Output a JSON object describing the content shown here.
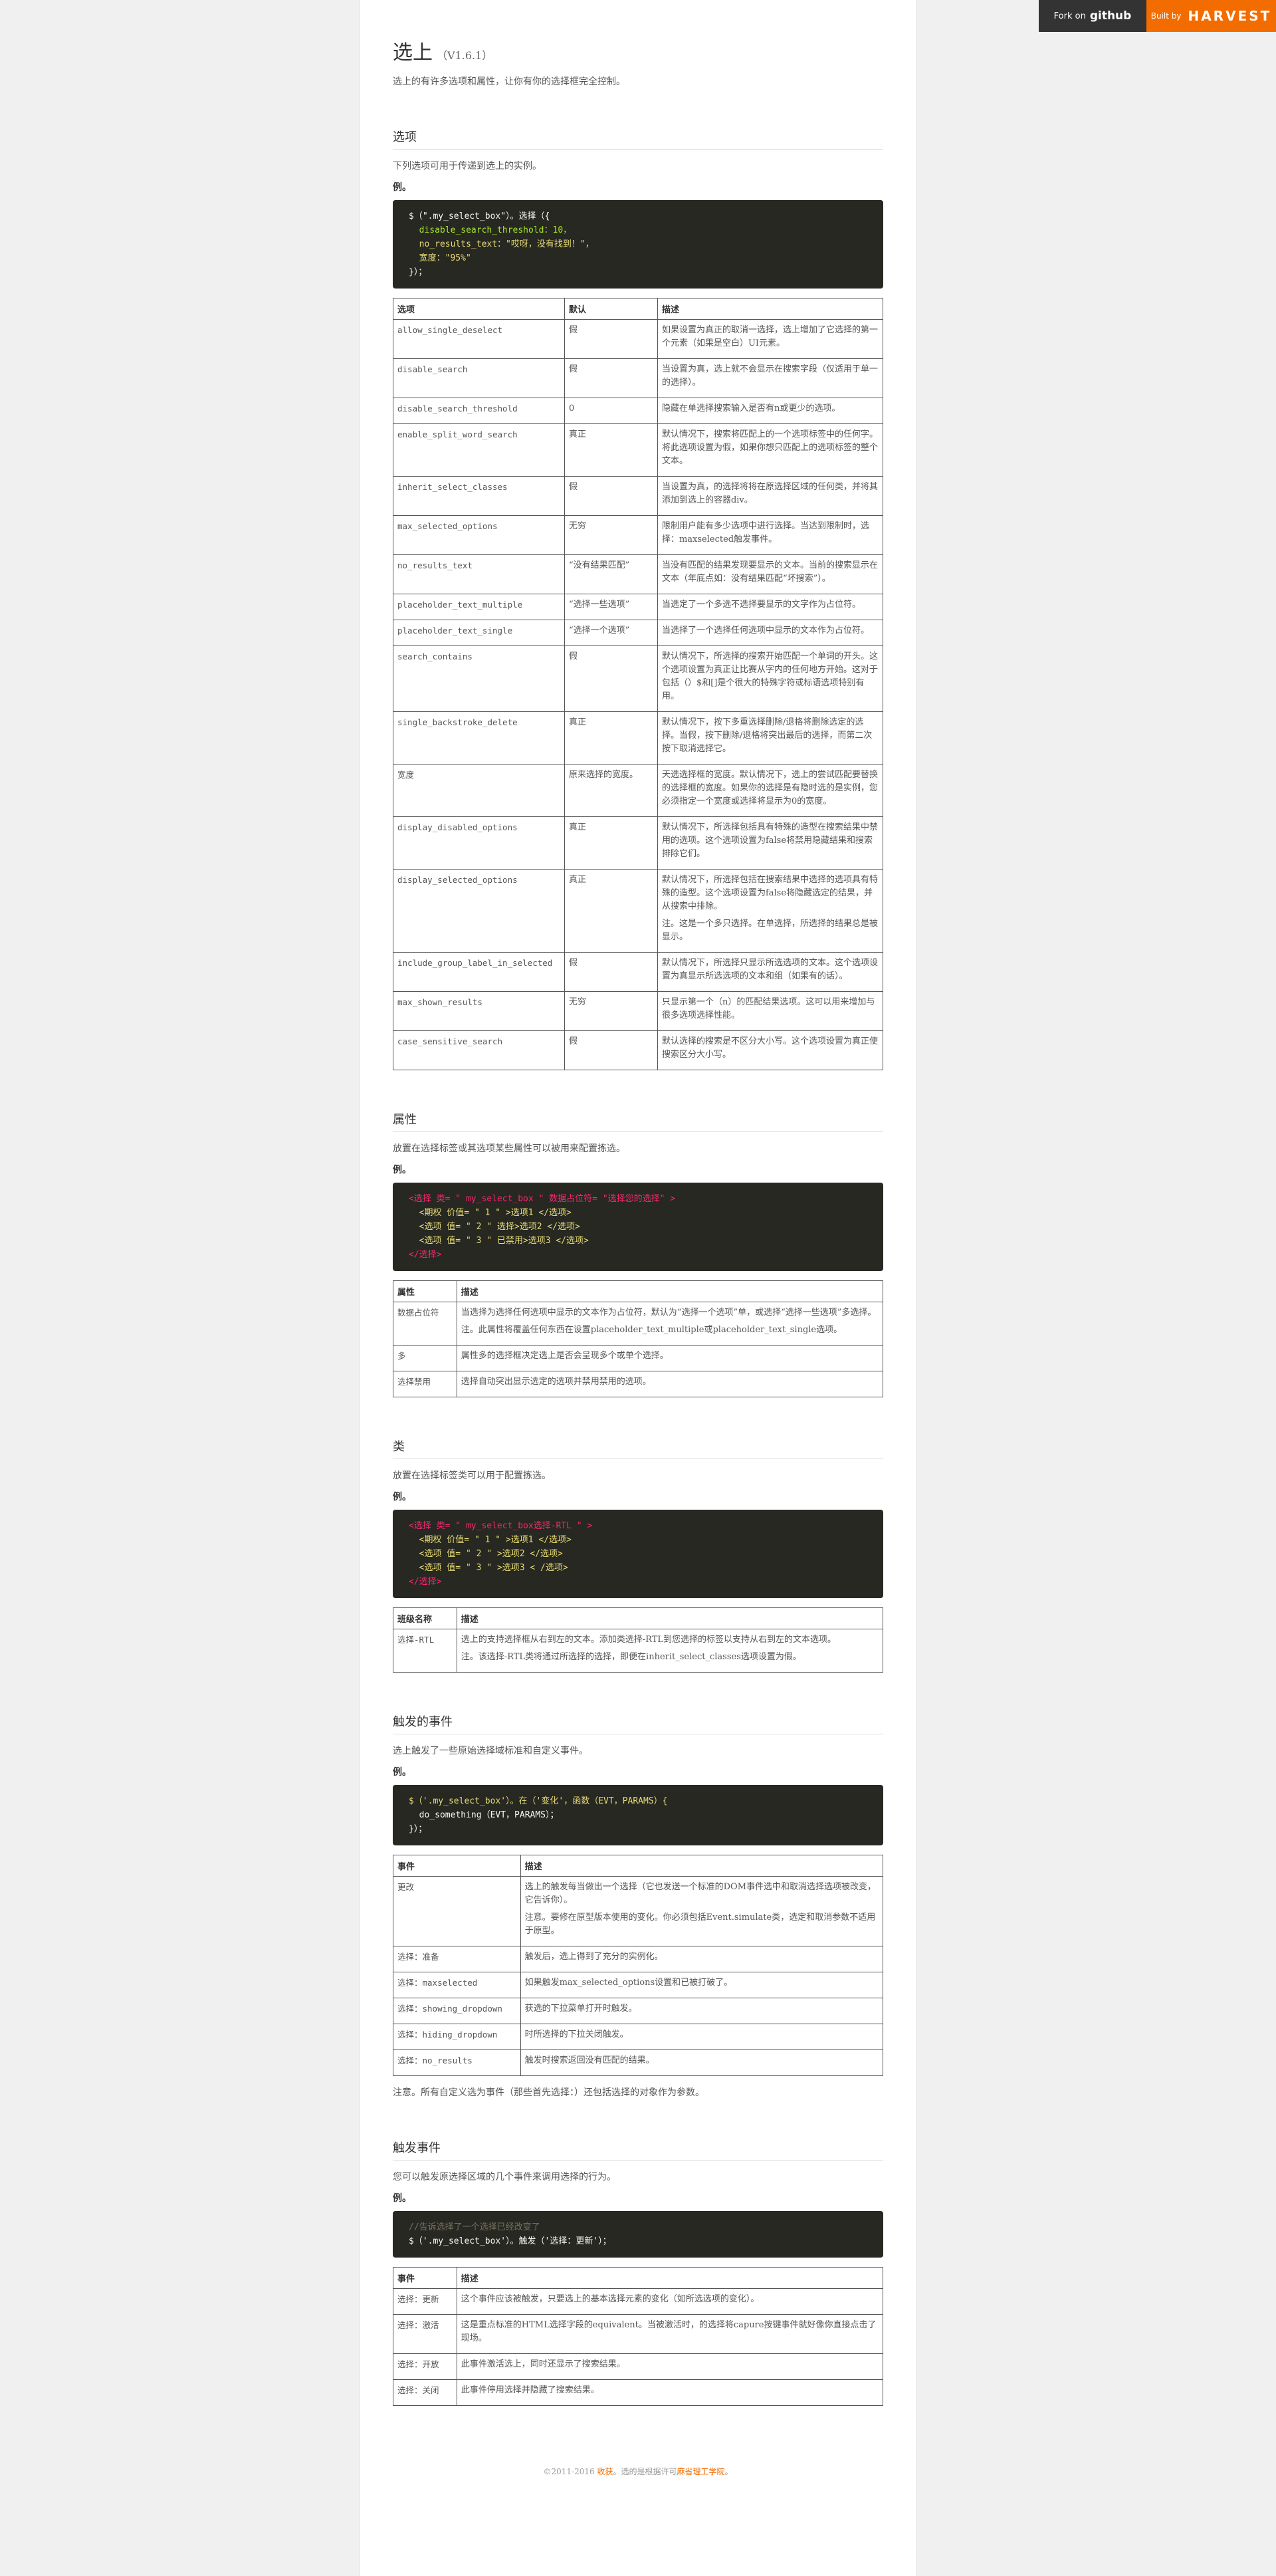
{
  "badges": {
    "github_prefix": "Fork on",
    "github_brand": "github",
    "harvest_prefix": "Built by",
    "harvest_brand": "HARVEST"
  },
  "header": {
    "title": "选上",
    "version": "（V1.6.1）",
    "lead": "选上的有许多选项和属性，让你有你的选择框完全控制。"
  },
  "options": {
    "heading": "选项",
    "desc": "下列选项可用于传递到选上的实例。",
    "example_label": "例。",
    "code": [
      "$（\".my_select_box\"）。选择（{",
      "  disable_search_threshold：10，",
      "  no_results_text：\"哎呀，没有找到！\"，",
      "  宽度：\"95%\"",
      "}）；"
    ],
    "headers": [
      "选项",
      "默认",
      "描述"
    ],
    "rows": [
      {
        "name": "allow_single_deselect",
        "def": "假",
        "desc": "如果设置为真正的取消一选择，选上增加了它选择的第一个元素（如果是空白）UI元素。"
      },
      {
        "name": "disable_search",
        "def": "假",
        "desc": "当设置为真，选上就不会显示在搜索字段（仅适用于单一的选择）。"
      },
      {
        "name": "disable_search_threshold",
        "def": "0",
        "desc": "隐藏在单选择搜索输入是否有n或更少的选项。"
      },
      {
        "name": "enable_split_word_search",
        "def": "真正",
        "desc": "默认情况下，搜索将匹配上的一个选项标签中的任何字。将此选项设置为假，如果你想只匹配上的选项标签的整个文本。"
      },
      {
        "name": "inherit_select_classes",
        "def": "假",
        "desc": "当设置为真，的选择将将在原选择区域的任何类，并将其添加到选上的容器div。"
      },
      {
        "name": "max_selected_options",
        "def": "无穷",
        "desc": "限制用户能有多少选项中进行选择。当达到限制时，选择：maxselected触发事件。"
      },
      {
        "name": "no_results_text",
        "def": "“没有结果匹配”",
        "desc": "当没有匹配的结果发现要显示的文本。当前的搜索显示在文本（年底点如：没有结果匹配“坏搜索”）。"
      },
      {
        "name": "placeholder_text_multiple",
        "def": "“选择一些选项”",
        "desc": "当选定了一个多选不选择要显示的文字作为占位符。"
      },
      {
        "name": "placeholder_text_single",
        "def": "“选择一个选项”",
        "desc": "当选择了一个选择任何选项中显示的文本作为占位符。"
      },
      {
        "name": "search_contains",
        "def": "假",
        "desc": "默认情况下，所选择的搜索开始匹配一个单词的开头。这个选项设置为真正让比赛从字内的任何地方开始。这对于包括（）$和[]是个很大的特殊字符或标语选项特别有用。"
      },
      {
        "name": "single_backstroke_delete",
        "def": "真正",
        "desc": "默认情况下，按下多重选择删除/退格将删除选定的选择。当假，按下删除/退格将突出最后的选择，而第二次按下取消选择它。"
      },
      {
        "name": "宽度",
        "def": "原来选择的宽度。",
        "desc": "天选选择框的宽度。默认情况下，选上的尝试匹配要替换的选择框的宽度。如果你的选择是有隐时选的是实例，您必须指定一个宽度或选择将显示为0的宽度。"
      },
      {
        "name": "display_disabled_options",
        "def": "真正",
        "desc": "默认情况下，所选择包括具有特殊的造型在搜索结果中禁用的选项。这个选项设置为false将禁用隐藏结果和搜索排除它们。"
      },
      {
        "name": "display_selected_options",
        "def": "真正",
        "desc": "默认情况下，所选择包括在搜索结果中选择的选项具有特殊的造型。这个选项设置为false将隐藏选定的结果，并从搜索中排除。",
        "note": "注。这是一个多只选择。在单选择，所选择的结果总是被显示。"
      },
      {
        "name": "include_group_label_in_selected",
        "def": "假",
        "desc": "默认情况下，所选择只显示所选选项的文本。这个选项设置为真显示所选选项的文本和组（如果有的话）。"
      },
      {
        "name": "max_shown_results",
        "def": "无穷",
        "desc": "只显示第一个（n）的匹配结果选项。这可以用来增加与很多选项选择性能。"
      },
      {
        "name": "case_sensitive_search",
        "def": "假",
        "desc": "默认选择的搜索是不区分大小写。这个选项设置为真正使搜索区分大小写。"
      }
    ]
  },
  "attributes": {
    "heading": "属性",
    "desc": "放置在选择标签或其选项某些属性可以被用来配置拣选。",
    "example_label": "例。",
    "code": [
      "<选择 类= \" my_select_box \" 数据占位符= \"选择您的选择\" >",
      "  <期权 价值= \" 1 \" >选项1 </选项>",
      "  <选项 值= \" 2 \" 选择>选项2 </选项>",
      "  <选项 值= \" 3 \" 已禁用>选项3 </选项>",
      "</选择>"
    ],
    "headers": [
      "属性",
      "描述"
    ],
    "rows": [
      {
        "name": "数据占位符",
        "desc": "当选择为选择任何选项中显示的文本作为占位符，默认为“选择一个选项”单，或选择“选择一些选项”多选择。",
        "note": "注。此属性将覆盖任何东西在设置placeholder_text_multiple或placeholder_text_single选项。"
      },
      {
        "name": "多",
        "desc": "属性多的选择框决定选上是否会呈现多个或单个选择。"
      },
      {
        "name": "选择禁用",
        "desc": "选择自动突出显示选定的选项并禁用禁用的选项。"
      }
    ]
  },
  "classes": {
    "heading": "类",
    "desc": "放置在选择标签类可以用于配置拣选。",
    "example_label": "例。",
    "code": [
      "<选择 类= \" my_select_box选择-RTL \" >",
      "  <期权 价值= \" 1 \" >选项1 </选项>",
      "  <选项 值= \" 2 \" >选项2 </选项>",
      "  <选项 值= \" 3 \" >选项3 < /选项>",
      "</选择>"
    ],
    "headers": [
      "班级名称",
      "描述"
    ],
    "rows": [
      {
        "name": "选择-RTL",
        "desc": "选上的支持选择框从右到左的文本。添加类选择-RTL到您选择的标签以支持从右到左的文本选项。",
        "note": "注。该选择-RTL类将通过所选择的选择，即便在inherit_select_classes选项设置为假。"
      }
    ]
  },
  "triggered_events": {
    "heading": "触发的事件",
    "desc": "选上触发了一些原始选择域标准和自定义事件。",
    "example_label": "例。",
    "code": [
      "$（'.my_select_box'）。在（'变化'，函数（EVT，PARAMS）{",
      "  do_something（EVT，PARAMS）；",
      "}）；"
    ],
    "headers": [
      "事件",
      "描述"
    ],
    "rows": [
      {
        "name": "更改",
        "desc": "选上的触发每当做出一个选择（它也发送一个标准的DOM事件选中和取消选择选项被改变，它告诉你）。",
        "note": "注意。要修在原型版本使用的变化。你必须包括Event.simulate类，选定和取消参数不适用于原型。"
      },
      {
        "name": "选择：准备",
        "desc": "触发后，选上得到了充分的实例化。"
      },
      {
        "name": "选择：maxselected",
        "desc": "如果触发max_selected_options设置和已被打破了。"
      },
      {
        "name": "选择：showing_dropdown",
        "desc": "获选的下拉菜单打开时触发。"
      },
      {
        "name": "选择：hiding_dropdown",
        "desc": "时所选择的下拉关闭触发。"
      },
      {
        "name": "选择：no_results",
        "desc": "触发时搜索返回没有匹配的结果。"
      }
    ],
    "footnote": "注意。所有自定义选为事件（那些首先选择：）还包括选择的对象作为参数。"
  },
  "triggerable_events": {
    "heading": "触发事件",
    "desc": "您可以触发原选择区域的几个事件来调用选择的行为。",
    "example_label": "例。",
    "code": [
      "//告诉选择了一个选择已经改变了",
      "$（'.my_select_box'）。触发（'选择：更新'）；"
    ],
    "headers": [
      "事件",
      "描述"
    ],
    "rows": [
      {
        "name": "选择：更新",
        "desc": "这个事件应该被触发，只要选上的基本选择元素的变化（如所选选项的变化）。"
      },
      {
        "name": "选择：激活",
        "desc": "这是重点标准的HTML选择字段的equivalent。当被激活时，的选择将capure按键事件就好像你直接点击了现场。"
      },
      {
        "name": "选择：开放",
        "desc": "此事件激活选上，同时还显示了搜索结果。"
      },
      {
        "name": "选择：关闭",
        "desc": "此事件停用选择并隐藏了搜索结果。"
      }
    ]
  },
  "footer": {
    "prefix": "©2011-2016 ",
    "link1": "收获",
    "mid": "。选的是根据许可",
    "link2": "麻省理工学院",
    "suffix": "。"
  }
}
